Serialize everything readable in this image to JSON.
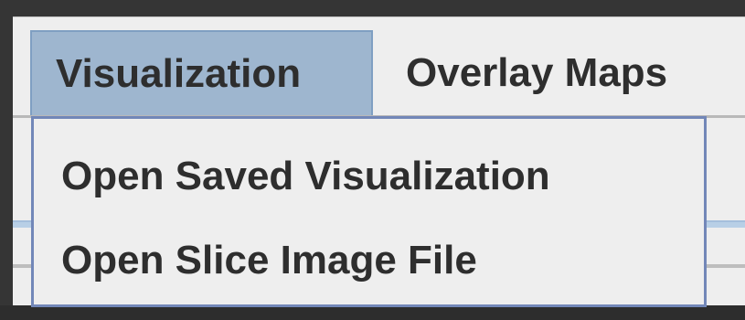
{
  "menubar": {
    "menus": [
      {
        "label": "Visualization",
        "selected": true
      },
      {
        "label": "Overlay Maps",
        "selected": false
      }
    ]
  },
  "dropdown": {
    "items": [
      {
        "label": "Open Saved Visualization"
      },
      {
        "label": "Open Slice Image File"
      }
    ]
  },
  "colors": {
    "selected_menu_bg": "#9eb6cf",
    "dropdown_border": "#7287b8",
    "menu_bg": "#eeeeee",
    "text": "#2e2e2e"
  }
}
